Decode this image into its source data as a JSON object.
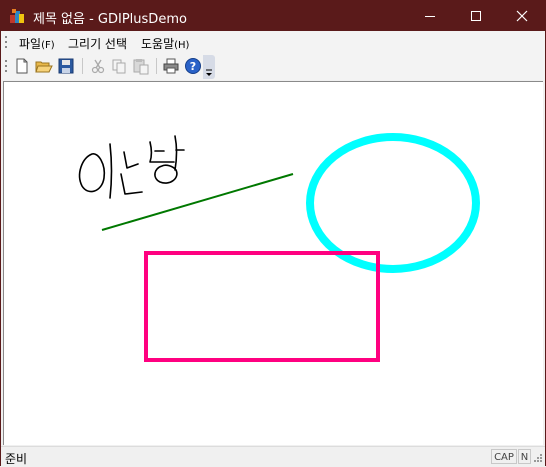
{
  "window": {
    "title": "제목 없음 - GDIPlusDemo",
    "titlebar_color": "#5a1a1a"
  },
  "menu": [
    {
      "label": "파일",
      "mnemonic": "(F)"
    },
    {
      "label": "그리기 선택",
      "mnemonic": ""
    },
    {
      "label": "도움말",
      "mnemonic": "(H)"
    }
  ],
  "toolbar": {
    "buttons": [
      "new-file-icon",
      "open-folder-icon",
      "save-disk-icon",
      "cut-icon",
      "copy-icon",
      "paste-icon",
      "print-icon",
      "help-icon"
    ],
    "disabled": [
      "cut-icon",
      "copy-icon",
      "paste-icon"
    ]
  },
  "canvas": {
    "shapes": [
      {
        "type": "freehand",
        "description": "handwritten 안녕",
        "color": "#000000"
      },
      {
        "type": "line",
        "color": "#007800"
      },
      {
        "type": "ellipse",
        "color": "#00ffff"
      },
      {
        "type": "rectangle",
        "color": "#ff0080"
      }
    ]
  },
  "statusbar": {
    "text": "준비",
    "caps": "CAP",
    "num": "N"
  }
}
